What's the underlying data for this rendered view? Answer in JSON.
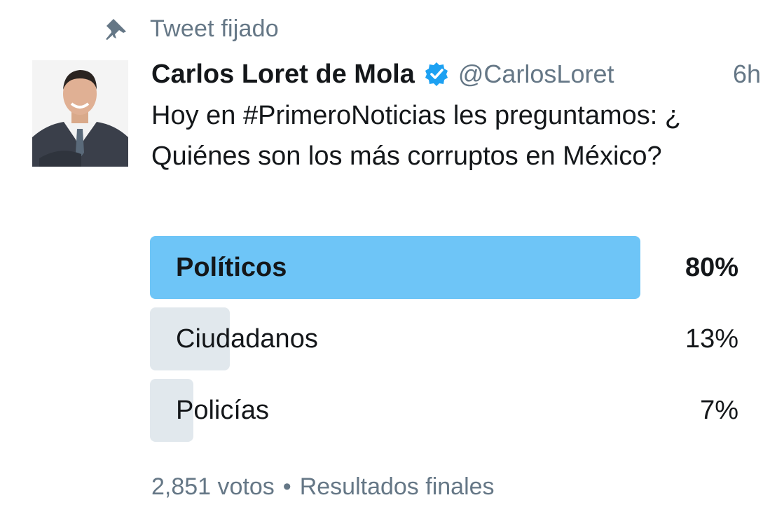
{
  "pinned": {
    "label": "Tweet fijado",
    "icon": "pin-icon"
  },
  "tweet": {
    "author_name": "Carlos Loret de Mola",
    "verified_icon": "verified-badge-icon",
    "handle": "@CarlosLoret",
    "timestamp": "6h",
    "text": "Hoy en #PrimeroNoticias les preguntamos: ¿ Quiénes son los más corruptos en México?"
  },
  "poll": {
    "options": [
      {
        "label": "Políticos",
        "percent_text": "80%",
        "percent": 80,
        "leading": true
      },
      {
        "label": "Ciudadanos",
        "percent_text": "13%",
        "percent": 13,
        "leading": false
      },
      {
        "label": "Policías",
        "percent_text": "7%",
        "percent": 7,
        "leading": false
      }
    ],
    "votes": "2,851 votos",
    "separator": "•",
    "status": "Resultados finales"
  },
  "colors": {
    "leading_bar": "#6ec5f7",
    "other_bar": "#e1e8ed",
    "secondary_text": "#657786",
    "primary_text": "#14171a",
    "verified": "#1da1f2"
  }
}
